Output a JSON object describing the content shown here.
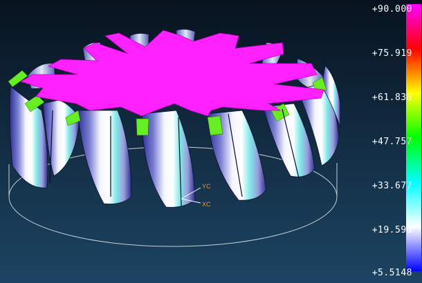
{
  "view": {
    "triad": {
      "y_label": "YC",
      "x_label": "XC"
    }
  },
  "legend": {
    "ticks": [
      "+90.000",
      "+75.919",
      "+61.838",
      "+47.757",
      "+33.677",
      "+19.596",
      "+5.5148"
    ],
    "colors": [
      "#ff00ff",
      "#ff0000",
      "#ffff00",
      "#00ff00",
      "#00ffff",
      "#ffffff",
      "#0000ff"
    ]
  }
}
